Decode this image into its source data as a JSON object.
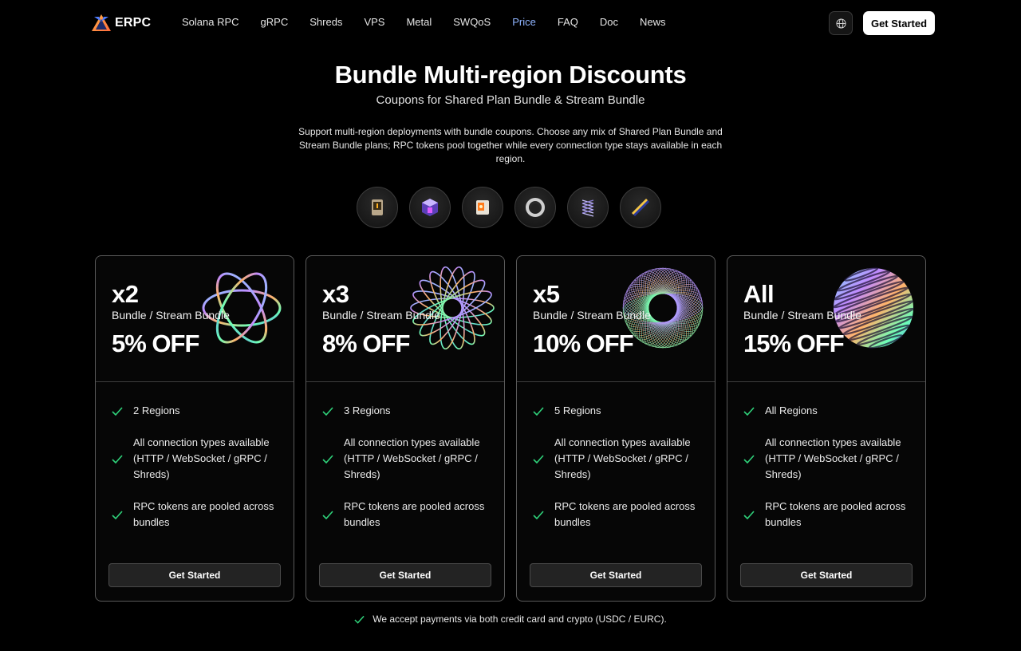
{
  "brand": {
    "name": "ERPC"
  },
  "nav": {
    "links": [
      "Solana RPC",
      "gRPC",
      "Shreds",
      "VPS",
      "Metal",
      "SWQoS",
      "Price",
      "FAQ",
      "Doc",
      "News"
    ],
    "active": "Price",
    "cta": "Get Started"
  },
  "hero": {
    "title": "Bundle Multi-region Discounts",
    "subtitle": "Coupons for Shared Plan Bundle & Stream Bundle",
    "description": "Support multi-region deployments with bundle coupons. Choose any mix of Shared Plan Bundle and Stream Bundle plans; RPC tokens pool together while every connection type stays available in each region."
  },
  "products": [
    "server-icon",
    "cube-icon",
    "box-icon",
    "ring-icon",
    "helix-icon",
    "blade-icon"
  ],
  "cards": [
    {
      "tier": "x2",
      "plan": "Bundle / Stream Bundle",
      "off": "5% OFF",
      "features": [
        "2 Regions",
        "All connection types available (HTTP / WebSocket / gRPC / Shreds)",
        "RPC tokens are pooled across bundles"
      ],
      "cta": "Get Started"
    },
    {
      "tier": "x3",
      "plan": "Bundle / Stream Bundle",
      "off": "8% OFF",
      "features": [
        "3 Regions",
        "All connection types available (HTTP / WebSocket / gRPC / Shreds)",
        "RPC tokens are pooled across bundles"
      ],
      "cta": "Get Started"
    },
    {
      "tier": "x5",
      "plan": "Bundle / Stream Bundle",
      "off": "10% OFF",
      "features": [
        "5 Regions",
        "All connection types available (HTTP / WebSocket / gRPC / Shreds)",
        "RPC tokens are pooled across bundles"
      ],
      "cta": "Get Started"
    },
    {
      "tier": "All",
      "plan": "Bundle / Stream Bundle",
      "off": "15% OFF",
      "features": [
        "All Regions",
        "All connection types available (HTTP / WebSocket / gRPC / Shreds)",
        "RPC tokens are pooled across bundles"
      ],
      "cta": "Get Started"
    }
  ],
  "footer": {
    "note": "We accept payments via both credit card and crypto (USDC / EURC)."
  },
  "colors": {
    "accent": "#8fb4ff",
    "check": "#2fd27a",
    "background": "#000000"
  }
}
